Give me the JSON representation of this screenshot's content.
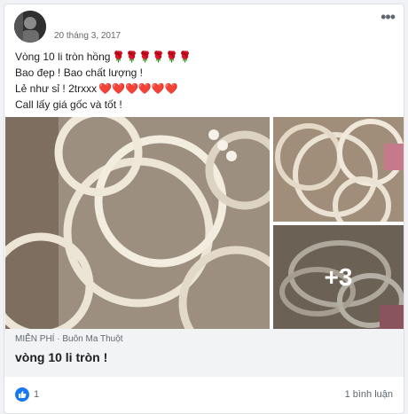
{
  "post": {
    "date": "20 tháng 3, 2017",
    "lines": [
      {
        "text": "Vòng 10 li tròn hồng",
        "emoji": "🌹🌹🌹🌹🌹🌹"
      },
      {
        "text": "Bao đẹp ! Bao chất lượng !",
        "emoji": ""
      },
      {
        "text": "Lẻ như sỉ ! 2trxxx",
        "emoji": "❤️❤️❤️❤️❤️❤️"
      },
      {
        "text": "Call lấy giá gốc và tốt !",
        "emoji": ""
      }
    ],
    "more_photos": "+3",
    "listing": {
      "price": "MIỄN PHÍ",
      "separator": "·",
      "location": "Buôn Ma Thuột",
      "title": "vòng 10 li tròn !"
    },
    "reactions": {
      "count": "1",
      "comments": "1 bình luận"
    }
  },
  "colors": {
    "accent": "#1877f2",
    "meta_bg": "#f2f3f5"
  },
  "icons": [
    "avatar",
    "more-options-icon",
    "like-reaction-icon"
  ]
}
